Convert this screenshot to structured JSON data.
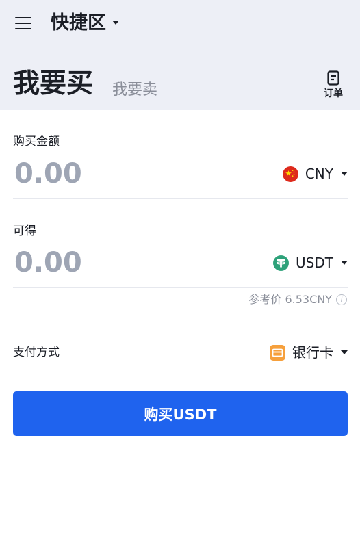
{
  "header": {
    "zone_title": "快捷区",
    "tab_buy": "我要买",
    "tab_sell": "我要卖",
    "orders_label": "订单",
    "icons": [
      "hamburger-menu-icon",
      "caret-down-icon",
      "order-document-icon"
    ]
  },
  "buy_amount": {
    "label": "购买金额",
    "placeholder": "0.00",
    "currency": "CNY",
    "currency_icon": "china-flag-icon"
  },
  "receive": {
    "label": "可得",
    "placeholder": "0.00",
    "currency": "USDT",
    "currency_icon": "tether-icon"
  },
  "reference_price": "参考价 6.53CNY",
  "payment": {
    "label": "支付方式",
    "method": "银行卡",
    "method_icon": "bank-card-icon"
  },
  "submit_label": "购买USDT",
  "colors": {
    "accent": "#1f63ee",
    "header_bg": "#edeff6",
    "placeholder": "#9ea5b4",
    "muted": "#8a8e99",
    "tether": "#2ea27a",
    "flag_red": "#de2a1c",
    "card_orange": "#f6a03c"
  }
}
